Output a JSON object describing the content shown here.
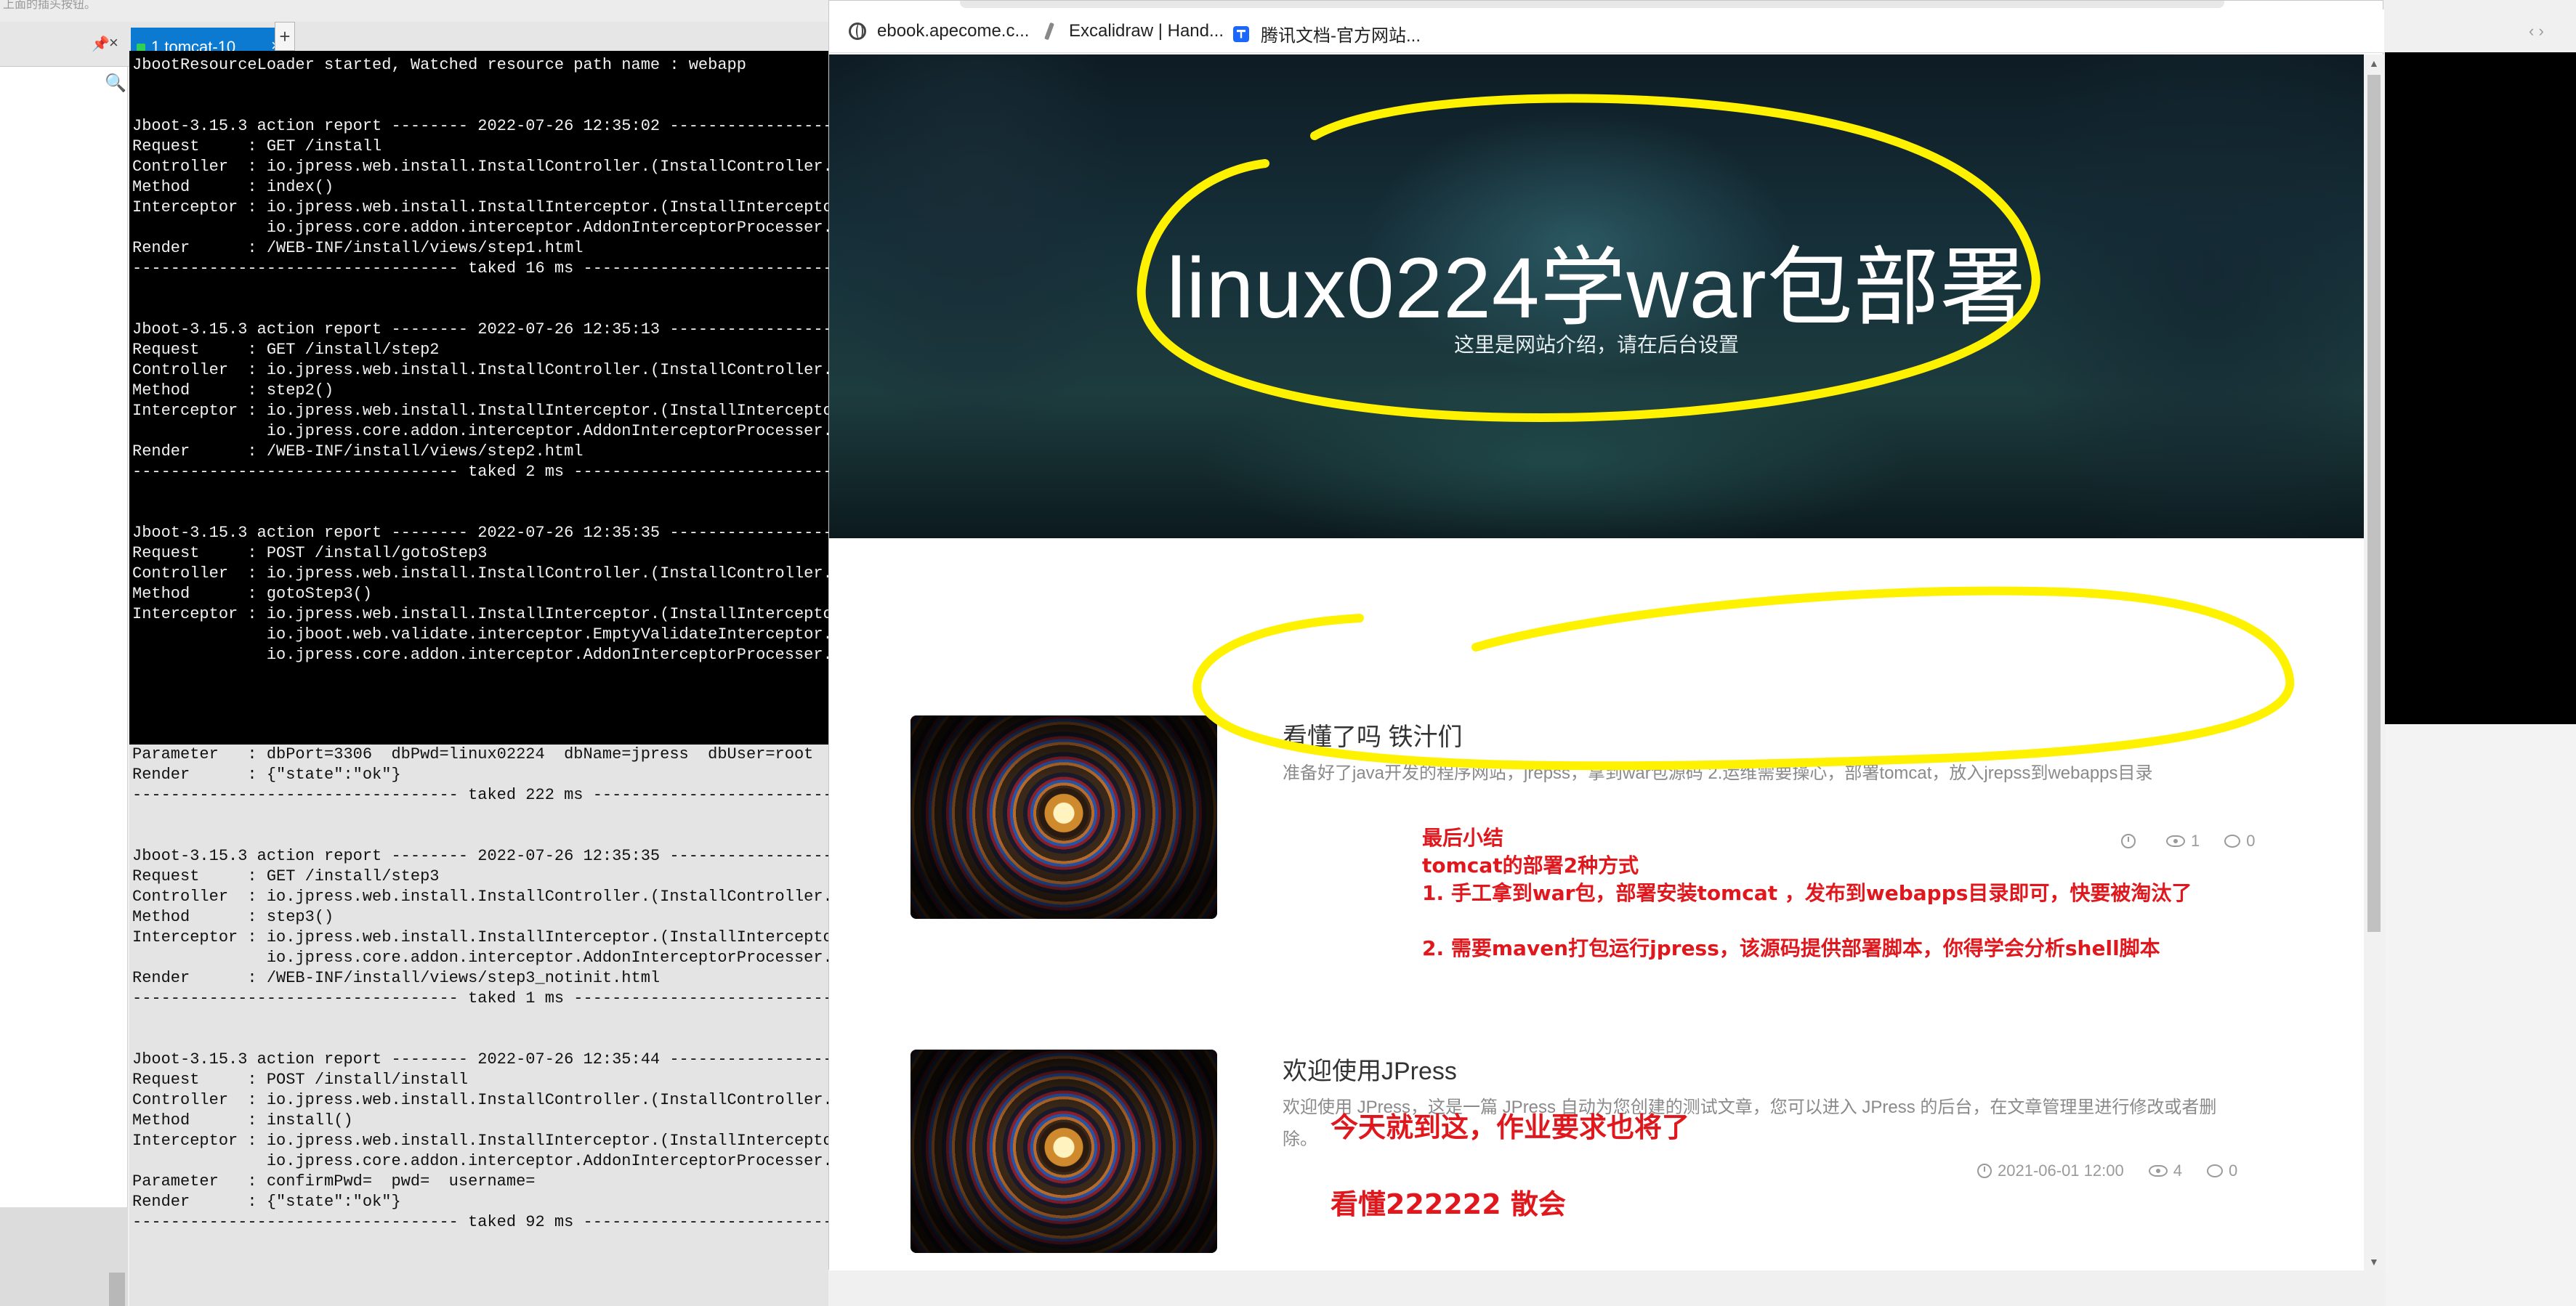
{
  "ide": {
    "top_hint": "上面的插头按钮。",
    "pin_icon": "pin-icon",
    "tab_label": "1 tomcat-10",
    "tab_close": "×",
    "tab_add": "+",
    "window_close": "×"
  },
  "terminal": {
    "text": "JbootResourceLoader started, Watched resource path name : webapp\n\n\nJboot-3.15.3 action report -------- 2022-07-26 12:35:02 --------------------\nRequest     : GET /install\nController  : io.jpress.web.install.InstallController.(InstallController.j\nMethod      : index()\nInterceptor : io.jpress.web.install.InstallInterceptor.(InstallInterceptor\n              io.jpress.core.addon.interceptor.AddonInterceptorProcesser.(\nRender      : /WEB-INF/install/views/step1.html\n---------------------------------- taked 16 ms ----------------------------\n\n\nJboot-3.15.3 action report -------- 2022-07-26 12:35:13 --------------------\nRequest     : GET /install/step2\nController  : io.jpress.web.install.InstallController.(InstallController.j\nMethod      : step2()\nInterceptor : io.jpress.web.install.InstallInterceptor.(InstallInterceptor\n              io.jpress.core.addon.interceptor.AddonInterceptorProcesser.(\nRender      : /WEB-INF/install/views/step2.html\n---------------------------------- taked 2 ms -----------------------------\n\n\nJboot-3.15.3 action report -------- 2022-07-26 12:35:35 --------------------\nRequest     : POST /install/gotoStep3\nController  : io.jpress.web.install.InstallController.(InstallController.j\nMethod      : gotoStep3()\nInterceptor : io.jpress.web.install.InstallInterceptor.(InstallInterceptor\n              io.jboot.web.validate.interceptor.EmptyValidateInterceptor.(\n              io.jpress.core.addon.interceptor.AddonInterceptorProcesser.(",
    "selected_text": "Parameter   : dbPort=3306  dbPwd=linux02224  dbName=jpress  dbUser=root  d\nRender      : {\"state\":\"ok\"}\n---------------------------------- taked 222 ms ---------------------------\n\n\nJboot-3.15.3 action report -------- 2022-07-26 12:35:35 --------------------\nRequest     : GET /install/step3\nController  : io.jpress.web.install.InstallController.(InstallController.j\nMethod      : step3()\nInterceptor : io.jpress.web.install.InstallInterceptor.(InstallInterceptor\n              io.jpress.core.addon.interceptor.AddonInterceptorProcesser.(\nRender      : /WEB-INF/install/views/step3_notinit.html\n---------------------------------- taked 1 ms -----------------------------\n\n\nJboot-3.15.3 action report -------- 2022-07-26 12:35:44 --------------------\nRequest     : POST /install/install\nController  : io.jpress.web.install.InstallController.(InstallController.j\nMethod      : install()\nInterceptor : io.jpress.web.install.InstallInterceptor.(InstallInterceptor\n              io.jpress.core.addon.interceptor.AddonInterceptorProcesser.(\nParameter   : confirmPwd=  pwd=  username=\nRender      : {\"state\":\"ok\"}\n---------------------------------- taked 92 ms ----------------------------"
  },
  "browser": {
    "bookmarks": [
      {
        "label": "ebook.apecome.c...",
        "icon": "globe-icon"
      },
      {
        "label": "Excalidraw | Hand...",
        "icon": "excalidraw-icon"
      },
      {
        "label": "腾讯文档-官方网站...",
        "icon": "tencent-docs-icon"
      }
    ],
    "page": {
      "site_title": "linux0224学war包部署",
      "site_subtitle": "这里是网站介绍，请在后台设置",
      "articles": [
        {
          "title": "看懂了吗 铁汁们",
          "summary": "准备好了java开发的程序网站，jrepss，拿到war包源码 2.运维需要操心，部署tomcat，放入jrepss到webapps目录",
          "views": "1",
          "comments": "0"
        },
        {
          "title": "欢迎使用JPress",
          "summary": "欢迎使用 JPress，这是一篇 JPress 自动为您创建的测试文章，您可以进入 JPress 的后台，在文章管理里进行修改或者删除。",
          "date": "2021-06-01 12:00",
          "views": "4",
          "comments": "0"
        }
      ]
    }
  },
  "annotations": {
    "summary_lines": [
      "最后小结",
      "tomcat的部署2种方式",
      "1. 手工拿到war包，部署安装tomcat ，发布到webapps目录即可，快要被淘汰了",
      "",
      "2. 需要maven打包运行jpress，该源码提供部署脚本，你得学会分析shell脚本"
    ],
    "today_line": "今天就到这，作业要求也将了",
    "bye_line": "看懂222222 散会",
    "ink_color": "#fff200",
    "note_color": "#e0181e"
  }
}
